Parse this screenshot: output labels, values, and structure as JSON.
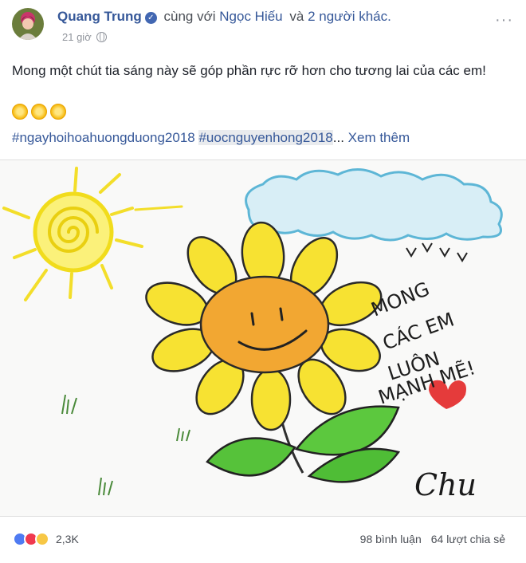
{
  "post": {
    "author": "Quang Trung",
    "with_text": "cùng với",
    "tagged_person": "Ngọc Hiếu",
    "and_text": "và",
    "others": "2 người khác.",
    "time": "21 giờ",
    "more_label": "···",
    "message": "Mong một chút tia sáng này sẽ góp phần rực rỡ hơn cho tương lai của các em!",
    "hashtags": [
      "#ngayhoihoahuongduong2018",
      "#uocnguyenhong2018"
    ],
    "ellipsis": "...",
    "see_more": "Xem thêm"
  },
  "drawing": {
    "message_lines": [
      "MONG",
      "CÁC EM",
      "LUÔN",
      "MẠNH MẼ!"
    ],
    "signature": "Chu"
  },
  "footer": {
    "reaction_count": "2,3K",
    "comments": "98 bình luận",
    "shares": "64 lượt chia sẻ"
  },
  "colors": {
    "link": "#365899",
    "sun": "#f5e23a",
    "petal": "#f6df2a",
    "center": "#f0a430",
    "leaf": "#4cbf3a",
    "cloud": "#5fb8d8",
    "heart": "#e53b3b"
  }
}
